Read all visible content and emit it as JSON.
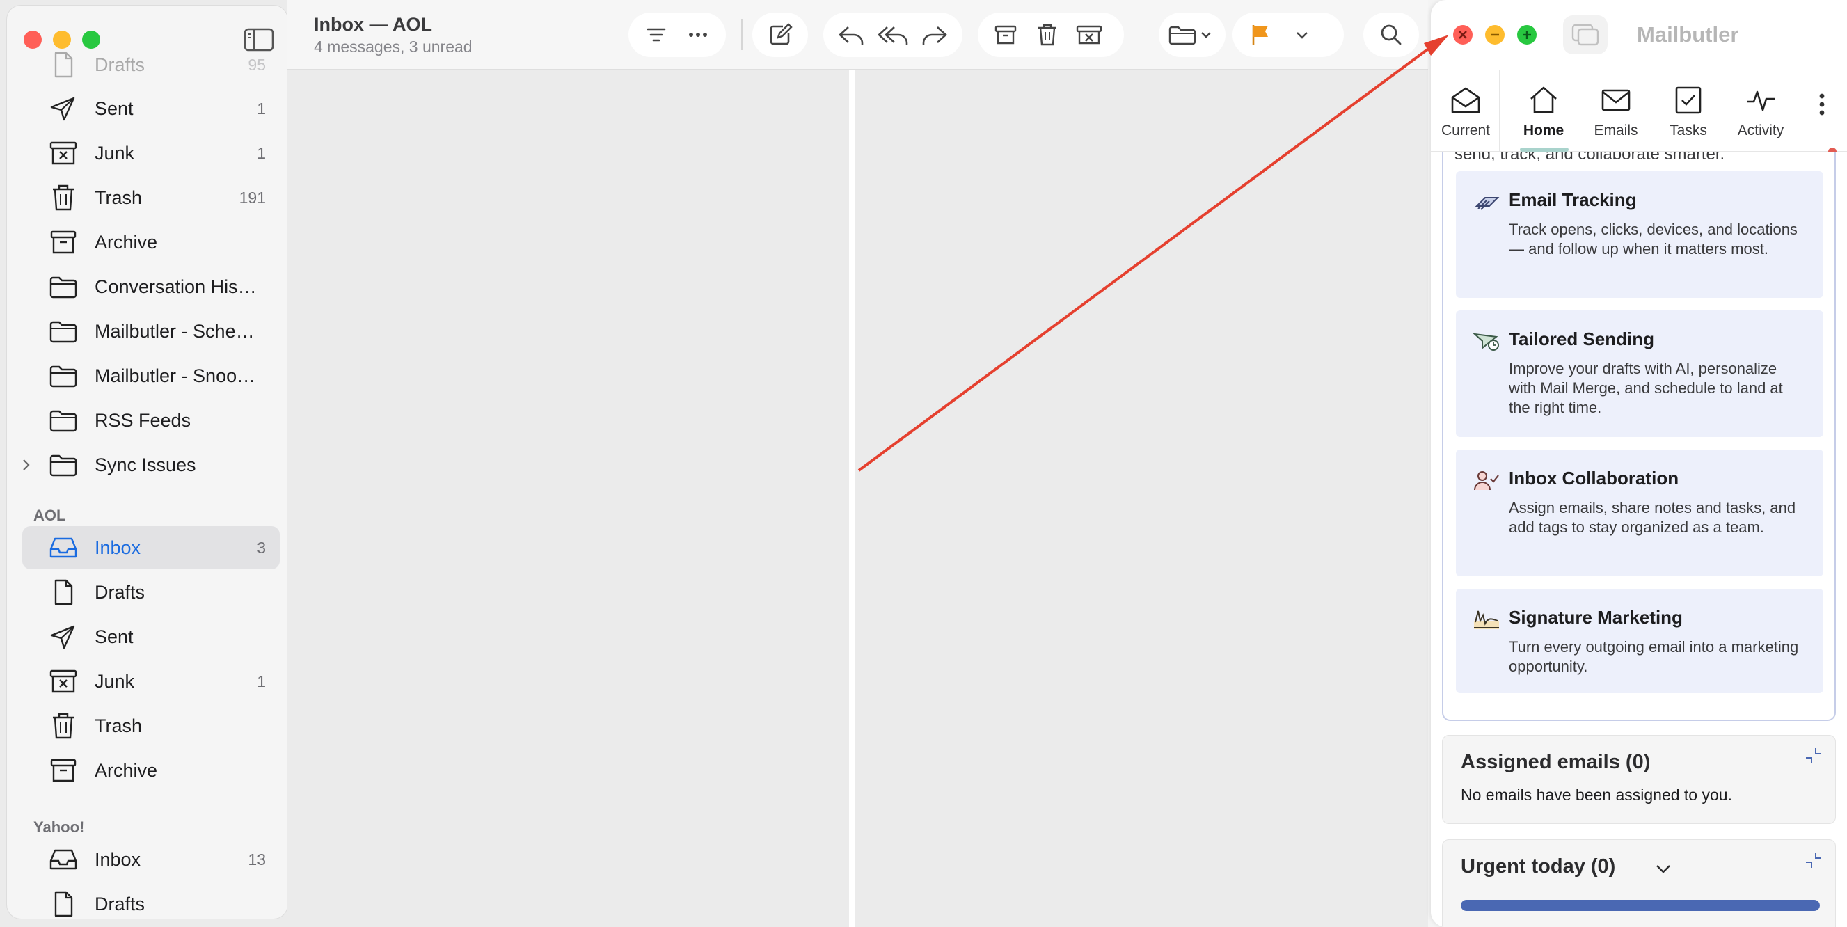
{
  "mail": {
    "header": {
      "title": "Inbox — AOL",
      "subtitle": "4 messages, 3 unread"
    },
    "sidebar": {
      "top_items": [
        {
          "label": "Drafts",
          "count": "95",
          "icon": "draft-icon"
        },
        {
          "label": "Sent",
          "count": "1",
          "icon": "paperplane-icon"
        },
        {
          "label": "Junk",
          "count": "1",
          "icon": "junk-icon"
        },
        {
          "label": "Trash",
          "count": "191",
          "icon": "trash-icon"
        },
        {
          "label": "Archive",
          "count": "",
          "icon": "archive-icon"
        },
        {
          "label": "Conversation Histo...",
          "count": "",
          "icon": "folder-icon"
        },
        {
          "label": "Mailbutler - Sched...",
          "count": "",
          "icon": "folder-icon"
        },
        {
          "label": "Mailbutler - Snooz...",
          "count": "",
          "icon": "folder-icon"
        },
        {
          "label": "RSS Feeds",
          "count": "",
          "icon": "folder-icon"
        },
        {
          "label": "Sync Issues",
          "count": "",
          "icon": "folder-icon"
        }
      ],
      "aol_section": "AOL",
      "aol_items": [
        {
          "label": "Inbox",
          "count": "3",
          "icon": "inbox-icon"
        },
        {
          "label": "Drafts",
          "count": "",
          "icon": "draft-icon"
        },
        {
          "label": "Sent",
          "count": "",
          "icon": "paperplane-icon"
        },
        {
          "label": "Junk",
          "count": "1",
          "icon": "junk-icon"
        },
        {
          "label": "Trash",
          "count": "",
          "icon": "trash-icon"
        },
        {
          "label": "Archive",
          "count": "",
          "icon": "archive-icon"
        }
      ],
      "yahoo_section": "Yahoo!",
      "yahoo_items": [
        {
          "label": "Inbox",
          "count": "13",
          "icon": "inbox-icon"
        },
        {
          "label": "Drafts",
          "count": "",
          "icon": "draft-icon"
        }
      ]
    },
    "colors": {
      "accent": "#1a6be0",
      "flag": "#f0961c",
      "close": "#ff5f57",
      "minimize": "#febc2e",
      "maximize": "#28c840"
    }
  },
  "mailbutler": {
    "title": "Mailbutler",
    "tabs": [
      {
        "label": "Current",
        "icon": "envelope-open-icon"
      },
      {
        "label": "Home",
        "icon": "home-icon"
      },
      {
        "label": "Emails",
        "icon": "envelope-icon"
      },
      {
        "label": "Tasks",
        "icon": "checkbox-icon"
      },
      {
        "label": "Activity",
        "icon": "activity-icon"
      }
    ],
    "intro": "send, track, and collaborate smarter.",
    "features": [
      {
        "title": "Email Tracking",
        "desc": "Track opens, clicks, devices, and locations — and follow up when it matters most.",
        "icon": "tracking-icon"
      },
      {
        "title": "Tailored Sending",
        "desc": "Improve your drafts with AI, personalize with Mail Merge, and schedule to land at the right time.",
        "icon": "sending-icon"
      },
      {
        "title": "Inbox Collaboration",
        "desc": "Assign emails, share notes and tasks, and add tags to stay organized as a team.",
        "icon": "collaboration-icon"
      },
      {
        "title": "Signature Marketing",
        "desc": "Turn every outgoing email into a marketing opportunity.",
        "icon": "signature-icon"
      }
    ],
    "assigned": {
      "title": "Assigned emails (0)",
      "text": "No emails have been assigned to you."
    },
    "urgent": {
      "title": "Urgent today (0)",
      "progress": 1.0
    },
    "colors": {
      "card_bg": "#edf0fb",
      "progress": "#4a68b3",
      "tab_underline": "#a9d3cc",
      "notification": "#e25b52"
    }
  }
}
